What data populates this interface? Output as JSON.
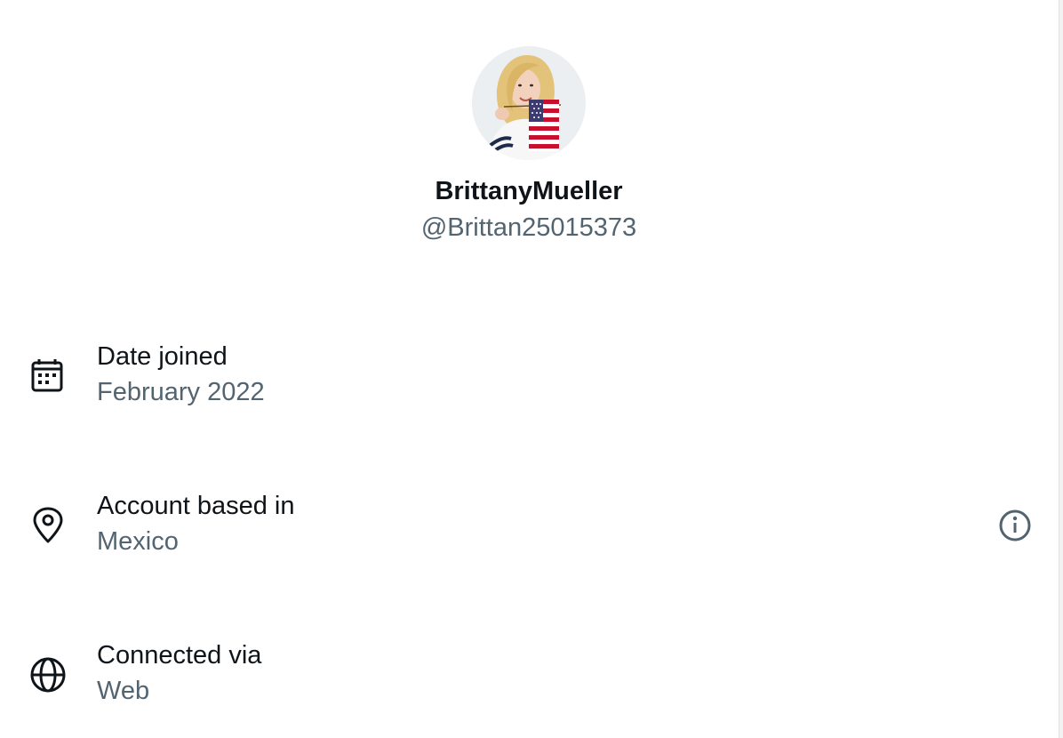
{
  "profile": {
    "display_name": "BrittanyMueller",
    "handle": "@Brittan25015373",
    "avatar_icon": "profile-photo"
  },
  "rows": [
    {
      "icon": "calendar-icon",
      "label": "Date joined",
      "value": "February 2022"
    },
    {
      "icon": "location-pin-icon",
      "label": "Account based in",
      "value": "Mexico",
      "action_icon": "info-icon"
    },
    {
      "icon": "globe-icon",
      "label": "Connected via",
      "value": "Web"
    }
  ],
  "colors": {
    "primary_text": "#0f1419",
    "secondary_text": "#536471",
    "background": "#ffffff"
  }
}
